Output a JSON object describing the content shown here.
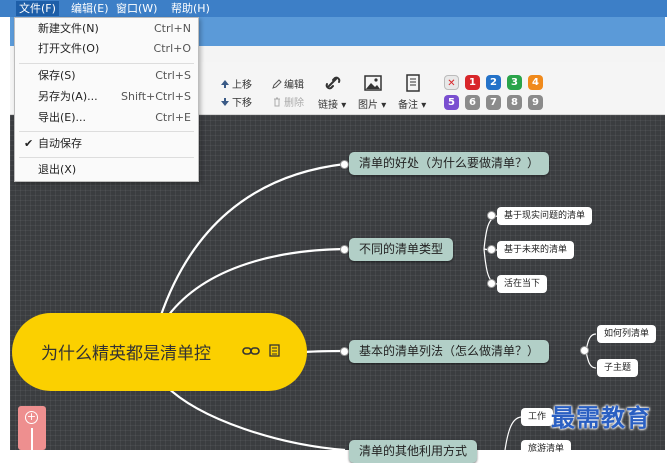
{
  "menubar": {
    "items": [
      {
        "label": "文件(F)"
      },
      {
        "label": "编辑(E)"
      },
      {
        "label": "窗口(W)"
      },
      {
        "label": "帮助(H)"
      }
    ]
  },
  "file_menu": {
    "new": {
      "label": "新建文件(N)",
      "shortcut": "Ctrl+N"
    },
    "open": {
      "label": "打开文件(O)",
      "shortcut": "Ctrl+O"
    },
    "save": {
      "label": "保存(S)",
      "shortcut": "Ctrl+S"
    },
    "save_as": {
      "label": "另存为(A)...",
      "shortcut": "Shift+Ctrl+S"
    },
    "export": {
      "label": "导出(E)...",
      "shortcut": "Ctrl+E"
    },
    "autosave": {
      "label": "自动保存",
      "check": "✔"
    },
    "exit": {
      "label": "退出(X)"
    }
  },
  "toolbar": {
    "move_up": "上移",
    "move_down": "下移",
    "edit": "编辑",
    "delete": "删除",
    "link": "链接",
    "image": "图片",
    "note": "备注",
    "dropdown_arrow": "▾",
    "priority_badges": [
      "1",
      "2",
      "3",
      "4",
      "5",
      "6",
      "7",
      "8",
      "9"
    ],
    "priority_colors": [
      "#d8262a",
      "#2472c8",
      "#2aa44a",
      "#f08a1c",
      "#7a4fd0",
      "#8b8b8b",
      "#8b8b8b",
      "#8b8b8b",
      "#8b8b8b"
    ],
    "remove_priority": "✕"
  },
  "mindmap": {
    "root": "为什么精英都是清单控",
    "root_link_icon": "link-icon",
    "root_note_icon": "note-icon",
    "branches": [
      {
        "label": "清单的好处（为什么要做清单？）"
      },
      {
        "label": "不同的清单类型",
        "children": [
          "基于现实问题的清单",
          "基于未来的清单",
          "活在当下"
        ]
      },
      {
        "label": "基本的清单列法（怎么做清单？）",
        "children": [
          "如何列清单",
          "子主题"
        ]
      },
      {
        "label": "清单的其他利用方式",
        "children": [
          "工作",
          "旅游清单"
        ]
      }
    ]
  },
  "zoom": {
    "plus": "+"
  },
  "watermark": "最需教育",
  "colors": {
    "menubar": "#3d7fc7",
    "canvas": "#3b3d40",
    "root": "#fbd000",
    "branch": "#b2cfc7"
  }
}
